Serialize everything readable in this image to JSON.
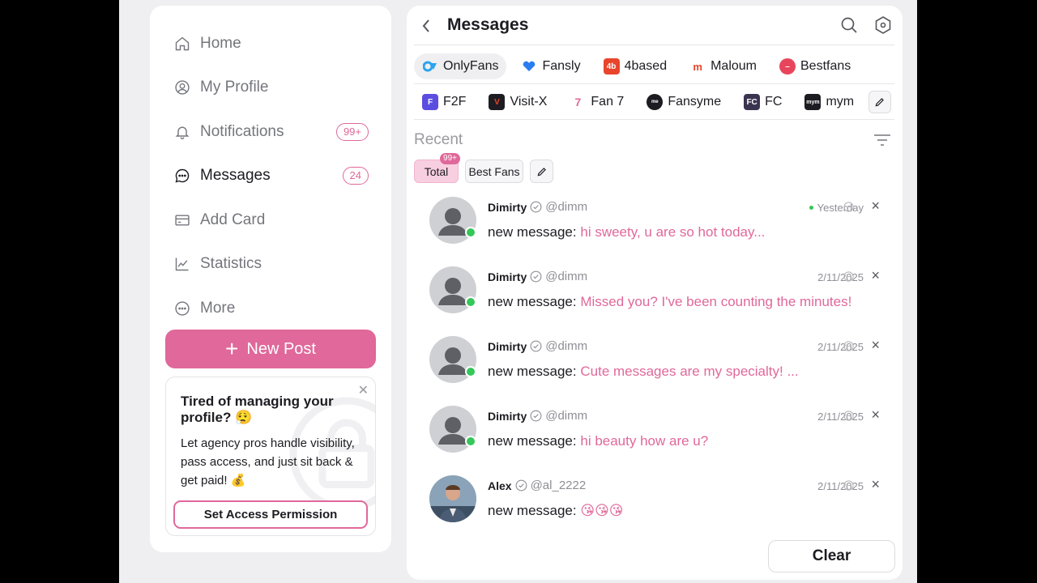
{
  "sidebar": {
    "items": [
      {
        "label": "Home",
        "icon": "home-icon"
      },
      {
        "label": "My Profile",
        "icon": "profile-icon"
      },
      {
        "label": "Notifications",
        "icon": "bell-icon",
        "badge": "99+"
      },
      {
        "label": "Messages",
        "icon": "chat-icon",
        "badge": "24"
      },
      {
        "label": "Add Card",
        "icon": "card-icon"
      },
      {
        "label": "Statistics",
        "icon": "chart-icon"
      },
      {
        "label": "More",
        "icon": "more-icon"
      }
    ],
    "new_post": "New Post",
    "promo": {
      "title": "Tired of managing your profile? 😮‍💨",
      "body": "Let agency pros handle visibility, pass access, and just sit back & get paid! 💰",
      "cta": "Set Access Permission",
      "close": "✕"
    }
  },
  "header": {
    "title": "Messages"
  },
  "platforms_row1": [
    {
      "label": "OnlyFans",
      "color": "#2aa3f0"
    },
    {
      "label": "Fansly",
      "color": "#2a7df0"
    },
    {
      "label": "4based",
      "color": "#e8452c"
    },
    {
      "label": "Maloum",
      "color": "#e8452c"
    },
    {
      "label": "Bestfans",
      "color": "#e8455c"
    }
  ],
  "platforms_row2": [
    {
      "label": "F2F",
      "color": "#5b4de0"
    },
    {
      "label": "Visit-X",
      "color": "#1c1c22"
    },
    {
      "label": "Fan 7",
      "color": "#e0689a"
    },
    {
      "label": "Fansyme",
      "color": "#1c1c22"
    },
    {
      "label": "FC",
      "color": "#3a3450"
    },
    {
      "label": "mym",
      "color": "#1c1c22"
    }
  ],
  "recent": {
    "title": "Recent",
    "chips": {
      "total": "Total",
      "total_count": "99+",
      "best": "Best Fans"
    }
  },
  "messages": [
    {
      "name": "Dimirty",
      "handle": "@dimm",
      "prefix": "new message:",
      "text": "hi sweety, u are so hot today...",
      "time": "Yesterday",
      "online": true,
      "time_dot": true
    },
    {
      "name": "Dimirty",
      "handle": "@dimm",
      "prefix": "new message:",
      "text": "Missed you? I've been counting the minutes!",
      "time": "2/11/2025",
      "online": true
    },
    {
      "name": "Dimirty",
      "handle": "@dimm",
      "prefix": "new message:",
      "text": "Cute messages are my specialty! ...",
      "time": "2/11/2025",
      "online": true
    },
    {
      "name": "Dimirty",
      "handle": "@dimm",
      "prefix": "new message:",
      "text": "hi beauty how are u?",
      "time": "2/11/2025",
      "online": true
    },
    {
      "name": "Alex",
      "handle": "@al_2222",
      "prefix": "new message:",
      "text": "😘😘😘",
      "time": "2/11/2025",
      "online": false
    }
  ],
  "clear_label": "Clear",
  "colors": {
    "accent": "#e0689a",
    "online": "#34c759"
  }
}
